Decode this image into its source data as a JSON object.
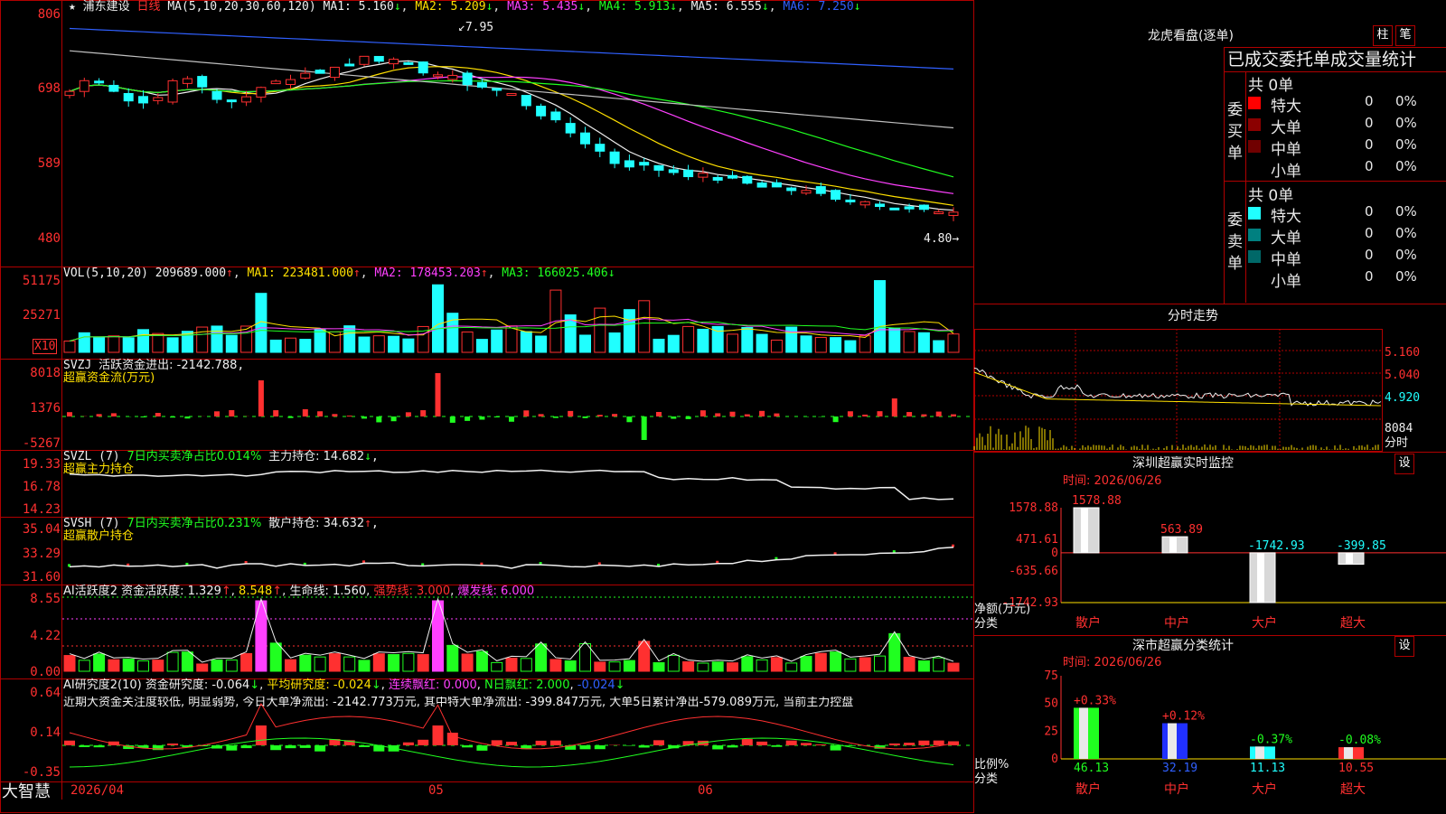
{
  "stock_name": "浦东建设",
  "period": "日线",
  "ma_header": {
    "params": "MA(5,10,20,30,60,120)",
    "ma1": "MA1: 5.160",
    "ma2": "MA2: 5.209",
    "ma3": "MA3: 5.435",
    "ma4": "MA4: 5.913",
    "ma5": "MA5: 6.555",
    "ma6": "MA6: 7.250"
  },
  "price_axis": [
    "806",
    "698",
    "589",
    "480"
  ],
  "price_labels": {
    "high": "7.95",
    "low": "4.80"
  },
  "vol_header": {
    "params": "VOL(5,10,20)",
    "value": "209689.000",
    "ma1": "MA1: 223481.000",
    "ma2": "MA2: 178453.203",
    "ma3": "MA3: 166025.406"
  },
  "vol_axis": [
    "51175",
    "25271"
  ],
  "vol_unit": "X10",
  "svzj": {
    "title": "SVZJ",
    "label": "活跃资金进出: -2142.788",
    "subtitle": "超赢资金流(万元)",
    "axis": [
      "8018",
      "1376",
      "-5267"
    ]
  },
  "svzl": {
    "title": "SVZL (7)",
    "ratio": "7日内买卖净占比0.014%",
    "hold": "主力持仓: 14.682",
    "subtitle": "超赢主力持仓",
    "axis": [
      "19.33",
      "16.78",
      "14.23"
    ]
  },
  "svsh": {
    "title": "SVSH (7)",
    "ratio": "7日内买卖净占比0.231%",
    "hold": "散户持仓: 34.632",
    "subtitle": "超赢散户持仓",
    "axis": [
      "35.04",
      "33.29",
      "31.60"
    ]
  },
  "ai_active": {
    "title": "AI活跃度2",
    "a": "资金活跃度: 1.329",
    "b": "8.548",
    "c": "生命线: 1.560",
    "d": "强势线: 3.000",
    "e": "爆发线: 6.000",
    "axis": [
      "8.55",
      "4.22",
      "0.00"
    ]
  },
  "ai_research": {
    "title": "AI研究度2(10)",
    "a": "资金研究度: -0.064",
    "b": "平均研究度: -0.024",
    "c": "连续飘红: 0.000",
    "d": "N日飘红: 2.000",
    "e": "-0.024",
    "axis": [
      "0.64",
      "0.14",
      "-0.35"
    ],
    "note": "近期大资金关注度较低, 明显弱势, 今日大单净流出: -2142.773万元, 其中特大单净流出: -399.847万元, 大单5日累计净出-579.089万元, 当前主力控盘"
  },
  "bottom": {
    "brand": "大智慧",
    "date1": "2026/04",
    "date2": "05",
    "date3": "06"
  },
  "right": {
    "dragon_title": "龙虎看盘(逐单)",
    "btn_col": "柱",
    "btn_brush": "笔",
    "stats_title": "已成交委托单成交量统计",
    "buy_side": "委买单",
    "sell_side": "委卖单",
    "buy_total": "共 0单",
    "sell_total": "共 0单",
    "buy_rows": [
      {
        "name": "特大",
        "count": "0",
        "pct": "0%"
      },
      {
        "name": "大单",
        "count": "0",
        "pct": "0%"
      },
      {
        "name": "中单",
        "count": "0",
        "pct": "0%"
      },
      {
        "name": "小单",
        "count": "0",
        "pct": "0%"
      }
    ],
    "sell_rows": [
      {
        "name": "特大",
        "count": "0",
        "pct": "0%"
      },
      {
        "name": "大单",
        "count": "0",
        "pct": "0%"
      },
      {
        "name": "中单",
        "count": "0",
        "pct": "0%"
      },
      {
        "name": "小单",
        "count": "0",
        "pct": "0%"
      }
    ],
    "intraday_title": "分时走势",
    "intraday_axis": [
      "5.160",
      "5.040",
      "4.920"
    ],
    "intraday_vol": "8084",
    "intraday_unit": "分时",
    "monitor_title": "深圳超赢实时监控",
    "monitor_btn": "设",
    "monitor_time": "时间: 2026/06/26",
    "monitor_axis": [
      "1578.88",
      "471.61",
      "0",
      "-635.66",
      "-1742.93"
    ],
    "monitor_ylabel": "净额(万元)",
    "monitor_xlabel": "分类",
    "classify_title": "深市超赢分类统计",
    "classify_btn": "设",
    "classify_time": "时间: 2026/06/26",
    "classify_axis": [
      "75",
      "50",
      "25",
      "0"
    ],
    "classify_ylabel": "比例%",
    "classify_xlabel": "分类"
  },
  "chart_data": [
    {
      "type": "bar",
      "title": "深圳超赢实时监控",
      "categories": [
        "散户",
        "中户",
        "大户",
        "超大"
      ],
      "values": [
        1578.88,
        563.89,
        -1742.93,
        -399.85
      ],
      "ylabel": "净额(万元)",
      "ylim": [
        -1742.93,
        1578.88
      ]
    },
    {
      "type": "bar",
      "title": "深市超赢分类统计",
      "categories": [
        "散户",
        "中户",
        "大户",
        "超大"
      ],
      "values": [
        46.13,
        32.19,
        11.13,
        10.55
      ],
      "changes": [
        "+0.33%",
        "+0.12%",
        "-0.37%",
        "-0.08%"
      ],
      "ylabel": "比例%",
      "ylim": [
        0,
        75
      ]
    }
  ]
}
